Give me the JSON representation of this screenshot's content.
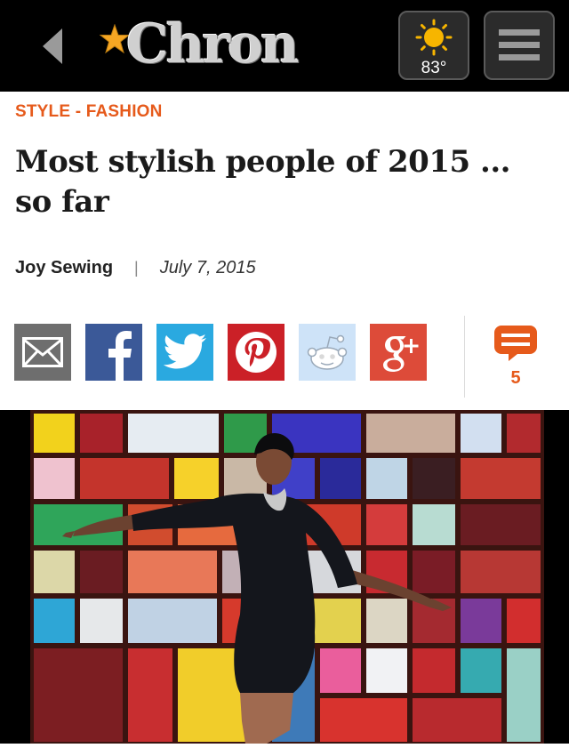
{
  "header": {
    "back_icon": "chevron-left-icon",
    "logo_text": "Chron",
    "logo_star_color": "#f5a623",
    "weather": {
      "temperature": "83°",
      "icon": "sun-icon"
    },
    "menu_icon": "hamburger-menu-icon"
  },
  "article": {
    "section": "STYLE - FASHION",
    "headline": "Most stylish people of 2015 ... so far",
    "author": "Joy Sewing",
    "separator": "|",
    "date": "July 7, 2015"
  },
  "share": {
    "items": [
      {
        "icon": "email-icon",
        "color": "#6e6e6e"
      },
      {
        "icon": "facebook-icon",
        "color": "#3b5998"
      },
      {
        "icon": "twitter-icon",
        "color": "#2aa9e0"
      },
      {
        "icon": "pinterest-icon",
        "color": "#cb2027"
      },
      {
        "icon": "reddit-icon",
        "color": "#cee3f8"
      },
      {
        "icon": "google-plus-icon",
        "color": "#dd4b39"
      }
    ],
    "comment_count": "5",
    "comment_color": "#e65a1b"
  },
  "colors": {
    "accent": "#e65a1b",
    "header_bg": "#000000"
  }
}
